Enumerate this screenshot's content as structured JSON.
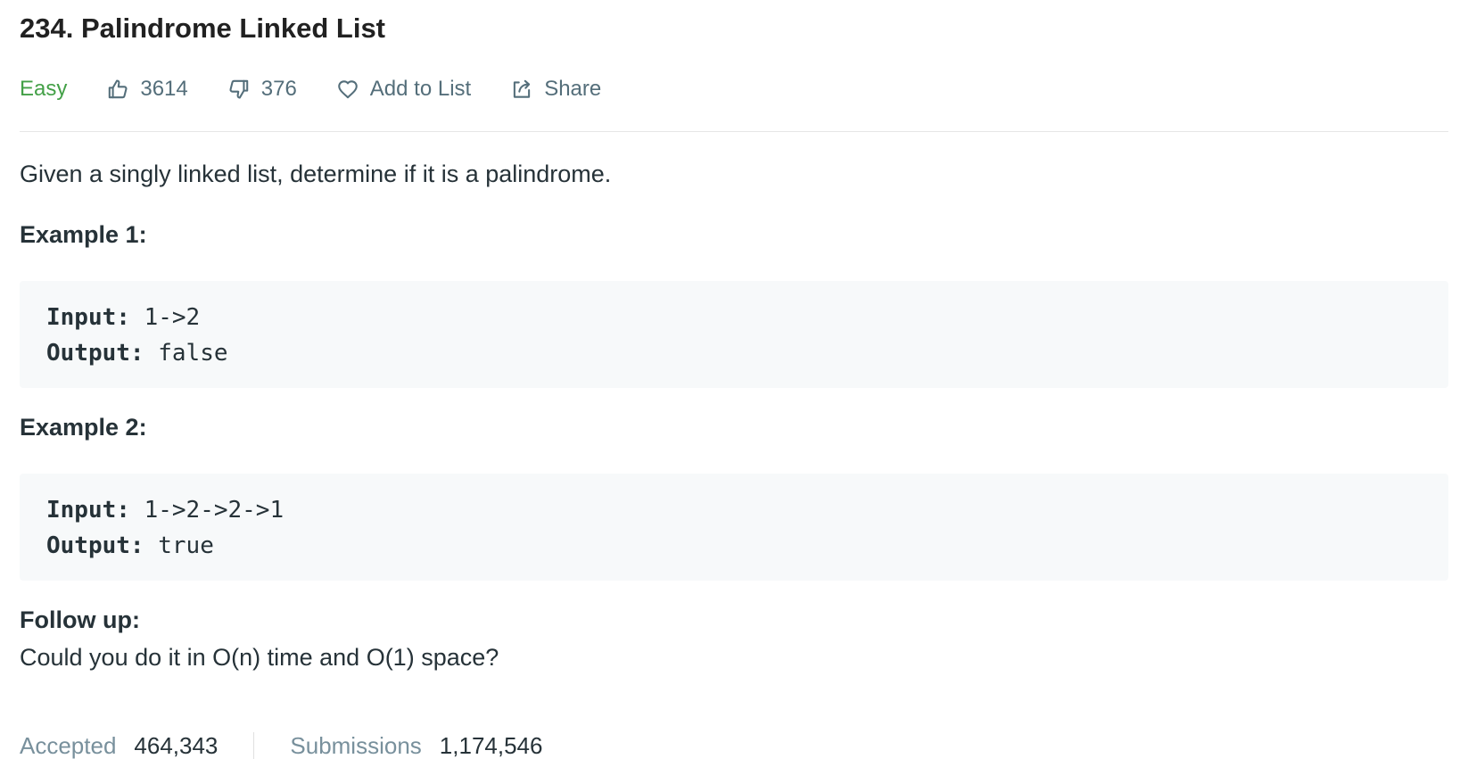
{
  "problem": {
    "title": "234. Palindrome Linked List",
    "difficulty": "Easy",
    "likes": "3614",
    "dislikes": "376",
    "add_to_list_label": "Add to List",
    "share_label": "Share"
  },
  "description": {
    "intro": "Given a singly linked list, determine if it is a palindrome.",
    "examples": [
      {
        "heading": "Example 1:",
        "input_label": "Input:",
        "input_value": " 1->2",
        "output_label": "Output:",
        "output_value": " false"
      },
      {
        "heading": "Example 2:",
        "input_label": "Input:",
        "input_value": " 1->2->2->1",
        "output_label": "Output:",
        "output_value": " true"
      }
    ],
    "follow_up_heading": "Follow up:",
    "follow_up_text": "Could you do it in O(n) time and O(1) space?"
  },
  "stats": {
    "accepted_label": "Accepted",
    "accepted_value": "464,343",
    "submissions_label": "Submissions",
    "submissions_value": "1,174,546"
  },
  "colors": {
    "difficulty_easy": "#43a047",
    "text": "#263238",
    "muted": "#546e7a",
    "code_background": "#f7f9fa"
  },
  "icons": [
    "thumbs-up-icon",
    "thumbs-down-icon",
    "heart-icon",
    "share-icon"
  ]
}
